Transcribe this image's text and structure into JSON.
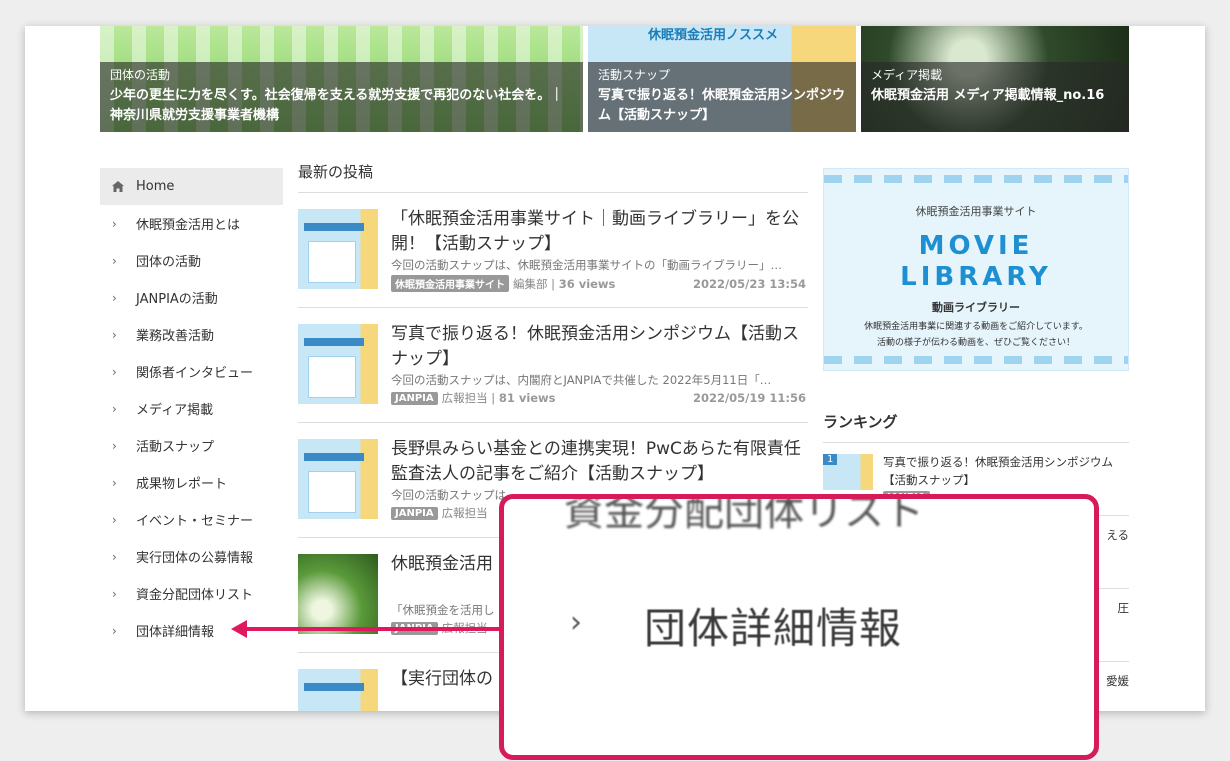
{
  "heroes": [
    {
      "category": "団体の活動",
      "title": "少年の更生に力を尽くす。社会復帰を支える就労支援で再犯のない社会を。｜神奈川県就労支援事業者機構"
    },
    {
      "category": "活動スナップ",
      "title": "写真で振り返る！休眠預金活用シンポジウム【活動スナップ】",
      "banner_text": "休眠預金活用ノススメ"
    },
    {
      "category": "メディア掲載",
      "title": "休眠預金活用 メディア掲載情報_no.16"
    }
  ],
  "sidebar": {
    "home": "Home",
    "items": [
      "休眠預金活用とは",
      "団体の活動",
      "JANPIAの活動",
      "業務改善活動",
      "関係者インタビュー",
      "メディア掲載",
      "活動スナップ",
      "成果物レポート",
      "イベント・セミナー",
      "実行団体の公募情報",
      "資金分配団体リスト",
      "団体詳細情報"
    ]
  },
  "main": {
    "heading": "最新の投稿",
    "posts": [
      {
        "title": "「休眠預金活用事業サイト｜動画ライブラリー」を公開！【活動スナップ】",
        "excerpt": "今回の活動スナップは、休眠預金活用事業サイトの「動画ライブラリー」…",
        "tag": "休眠預金活用事業サイト",
        "author": "編集部",
        "views": "36 views",
        "date": "2022/05/23 13:54"
      },
      {
        "title": "写真で振り返る！休眠預金活用シンポジウム【活動スナップ】",
        "excerpt": "今回の活動スナップは、内閣府とJANPIAで共催した 2022年5月11日「…",
        "tag": "JANPIA",
        "author": "広報担当",
        "views": "81 views",
        "date": "2022/05/19 11:56"
      },
      {
        "title": "長野県みらい基金との連携実現！PwCあらた有限責任監査法人の記事をご紹介【活動スナップ】",
        "excerpt": "今回の活動スナップは",
        "tag": "JANPIA",
        "author": "広報担当",
        "views": "",
        "date": ""
      },
      {
        "title": "休眠預金活用",
        "excerpt": "「休眠預金を活用し",
        "tag": "JANPIA",
        "author": "広報担当",
        "views": "",
        "date": ""
      },
      {
        "title": "【実行団体の",
        "excerpt": "",
        "tag": "",
        "author": "",
        "views": "",
        "date": ""
      }
    ]
  },
  "movie_banner": {
    "site": "休眠預金活用事業サイト",
    "line1": "MOVIE",
    "line2": "LIBRARY",
    "sub": "動画ライブラリー",
    "desc1": "休眠預金活用事業に関連する動画をご紹介しています。",
    "desc2": "活動の様子が伝わる動画を、ぜひご覧ください！"
  },
  "ranking": {
    "heading": "ランキング",
    "items": [
      {
        "num": "1",
        "title": "写真で振り返る！休眠預金活用シンポジウム【活動スナップ】",
        "tag": "JANPIA"
      },
      {
        "num": "",
        "title": "える",
        "tag": ""
      },
      {
        "num": "",
        "title": "圧",
        "tag": ""
      },
      {
        "num": "",
        "title": "愛媛",
        "tag": ""
      }
    ]
  },
  "zoom": {
    "prev_text": "資金分配団体リスト",
    "chevron": "›",
    "text": "団体詳細情報"
  },
  "colors": {
    "accent": "#e0195f",
    "link_blue": "#1e8fd0"
  }
}
